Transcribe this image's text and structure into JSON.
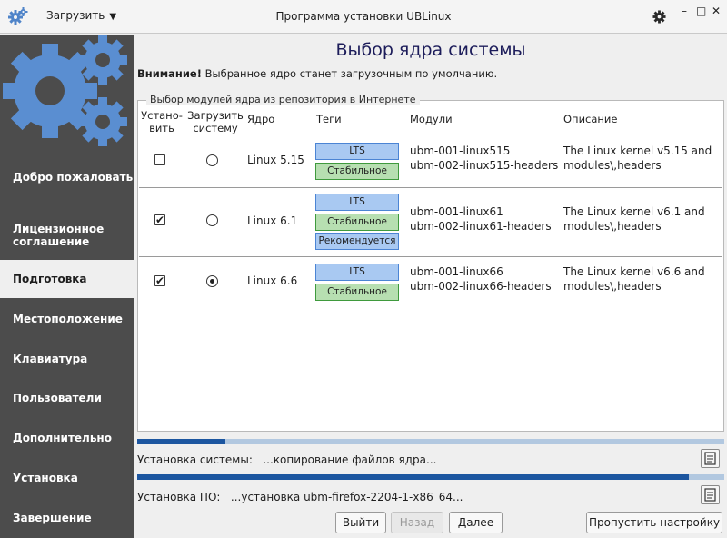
{
  "window": {
    "title": "Программа установки UBLinux",
    "menu_label": "Загрузить",
    "menu_arrow": "▼",
    "minimize": "–",
    "maximize": "□",
    "close": "✕"
  },
  "sidebar": {
    "items": [
      {
        "label": "Добро пожаловать",
        "active": false
      },
      {
        "label": "Лицензионное соглашение",
        "active": false
      },
      {
        "label": "Подготовка",
        "active": true
      },
      {
        "label": "Местоположение",
        "active": false
      },
      {
        "label": "Клавиатура",
        "active": false
      },
      {
        "label": "Пользователи",
        "active": false
      },
      {
        "label": "Дополнительно",
        "active": false
      },
      {
        "label": "Установка",
        "active": false
      },
      {
        "label": "Завершение",
        "active": false
      }
    ]
  },
  "page": {
    "title": "Выбор ядра системы",
    "warning_bold": "Внимание!",
    "warning_text": "Выбранное ядро станет загрузочным по умолчанию."
  },
  "group": {
    "legend": "Выбор модулей ядра из репозитория в Интернете",
    "headers": {
      "install": "Устано-\nвить",
      "boot": "Загрузить\nсистему",
      "kernel": "Ядро",
      "tags": "Теги",
      "modules": "Модули",
      "description": "Описание"
    },
    "rows": [
      {
        "install": false,
        "boot": false,
        "kernel": "Linux 5.15",
        "tags": [
          "LTS",
          "Стабильное"
        ],
        "modules": [
          "ubm-001-linux515",
          "ubm-002-linux515-headers"
        ],
        "description": [
          "The Linux kernel v5.15 and",
          "modules\\,headers"
        ]
      },
      {
        "install": true,
        "boot": false,
        "kernel": "Linux 6.1",
        "tags": [
          "LTS",
          "Стабильное",
          "Рекомендуется"
        ],
        "modules": [
          "ubm-001-linux61",
          "ubm-002-linux61-headers"
        ],
        "description": [
          "The Linux kernel v6.1 and",
          "modules\\,headers"
        ]
      },
      {
        "install": true,
        "boot": true,
        "kernel": "Linux 6.6",
        "tags": [
          "LTS",
          "Стабильное"
        ],
        "modules": [
          "ubm-001-linux66",
          "ubm-002-linux66-headers"
        ],
        "description": [
          "The Linux kernel v6.6 and",
          "modules\\,headers"
        ]
      }
    ]
  },
  "progress": {
    "system_label": "Установка системы:",
    "system_status": "...копирование файлов ядра...",
    "system_fraction": 0.15,
    "software_label": "Установка ПО:",
    "software_status": "...установка ubm-firefox-2204-1-x86_64...",
    "software_fraction": 0.94
  },
  "buttons": {
    "exit": "Выйти",
    "back": "Назад",
    "next": "Далее",
    "skip": "Пропустить настройку"
  },
  "colors": {
    "sidebar_bg": "#4c4c4c",
    "accent_blue": "#1c56a0",
    "logo_blue": "#5a8ed1"
  }
}
